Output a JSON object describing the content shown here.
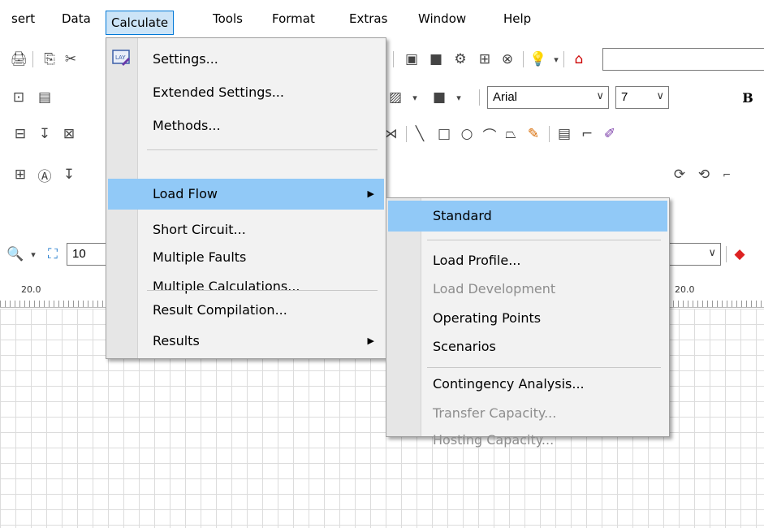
{
  "menubar": {
    "items": [
      "sert",
      "Data",
      "Calculate",
      "Tools",
      "Format",
      "Extras",
      "Window",
      "Help"
    ]
  },
  "toolbar": {
    "font_name": "Arial",
    "font_size": "7",
    "bold_label": "B",
    "zoom_value": "10"
  },
  "ruler": {
    "left_tick": "20.0",
    "right_tick": "20.0"
  },
  "calculate_menu": {
    "items": [
      {
        "label": "Settings...",
        "icon": "settings-icon"
      },
      {
        "label": "Extended Settings..."
      },
      {
        "label": "Methods..."
      },
      {
        "label": "Load Flow",
        "has_submenu": true,
        "highlighted": true
      },
      {
        "label": "Short Circuit..."
      },
      {
        "label": "Multiple Faults"
      },
      {
        "label": "Multiple Calculations..."
      },
      {
        "label": "Result Compilation..."
      },
      {
        "label": "Results",
        "has_submenu": true
      }
    ]
  },
  "loadflow_submenu": {
    "items": [
      {
        "label": "Standard",
        "highlighted": true
      },
      {
        "label": "Load Profile..."
      },
      {
        "label": "Load Development",
        "disabled": true
      },
      {
        "label": "Operating Points"
      },
      {
        "label": "Scenarios"
      },
      {
        "label": "Contingency Analysis..."
      },
      {
        "label": "Transfer Capacity...",
        "disabled": true
      },
      {
        "label": "Hosting Capacity...",
        "disabled": true
      }
    ]
  },
  "colors": {
    "menu_highlight": "#91c9f7",
    "active_menubar_bg": "#cce4f7",
    "active_menubar_border": "#0078d7",
    "disabled_text": "#8d8d8d"
  }
}
